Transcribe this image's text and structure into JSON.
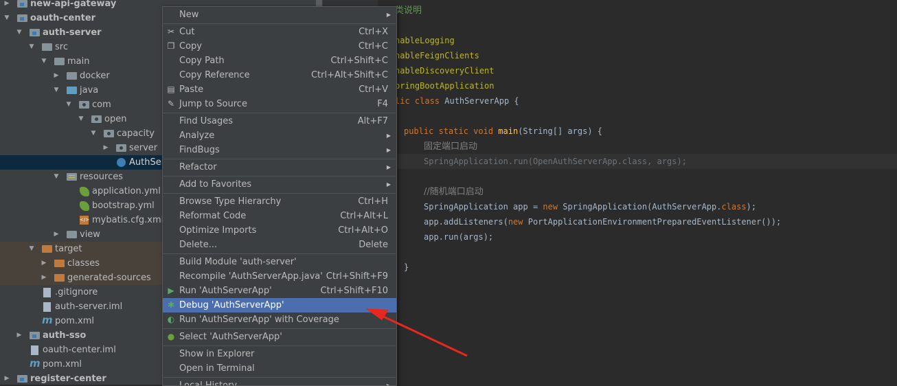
{
  "tree": [
    {
      "label": "new-api-gateway",
      "bold": true
    },
    {
      "label": "oauth-center",
      "bold": true
    },
    {
      "label": "auth-server",
      "bold": true
    },
    {
      "label": "src"
    },
    {
      "label": "main"
    },
    {
      "label": "docker"
    },
    {
      "label": "java"
    },
    {
      "label": "com"
    },
    {
      "label": "open"
    },
    {
      "label": "capacity"
    },
    {
      "label": "server"
    },
    {
      "label": "AuthServ"
    },
    {
      "label": "resources"
    },
    {
      "label": "application.yml"
    },
    {
      "label": "bootstrap.yml"
    },
    {
      "label": "mybatis.cfg.xml"
    },
    {
      "label": "view"
    },
    {
      "label": "target"
    },
    {
      "label": "classes"
    },
    {
      "label": "generated-sources"
    },
    {
      "label": ".gitignore"
    },
    {
      "label": "auth-server.iml"
    },
    {
      "label": "pom.xml"
    },
    {
      "label": "auth-sso",
      "bold": true
    },
    {
      "label": "oauth-center.iml"
    },
    {
      "label": "pom.xml"
    },
    {
      "label": "register-center",
      "bold": true
    }
  ],
  "editor": {
    "comment_top": "类说明",
    "annotations": [
      "nableLogging",
      "nableFeignClients",
      "nableDiscoveryClient",
      "pringBootApplication"
    ],
    "class_decl": {
      "kw": "lic class ",
      "name": "AuthServerApp {"
    },
    "main_decl": {
      "kw": "public static void ",
      "fn": "main",
      "rest": "(String[] args) {"
    },
    "comment_fixed": "固定端口启动",
    "fixed_run": "SpringApplication.run(OpenAuthServerApp.class, args);",
    "comment_random": "//随机端口启动",
    "line_app": {
      "a": "SpringApplication app = ",
      "kw": "new ",
      "b": "SpringApplication(AuthServerApp.",
      "kw2": "class",
      "c": ");"
    },
    "line_listeners": {
      "a": "app.addListeners(",
      "kw": "new ",
      "b": "PortApplicationEnvironmentPreparedEventListener());"
    },
    "line_run": "app.run(args);",
    "close_brace": "}"
  },
  "menu": [
    {
      "label": "New",
      "shortcut": "",
      "submenu": true
    },
    {
      "label": "Cut",
      "shortcut": "Ctrl+X",
      "icon": "cut-icon",
      "glyph": "✂"
    },
    {
      "label": "Copy",
      "shortcut": "Ctrl+C",
      "icon": "copy-icon",
      "glyph": "❐"
    },
    {
      "label": "Copy Path",
      "shortcut": "Ctrl+Shift+C"
    },
    {
      "label": "Copy Reference",
      "shortcut": "Ctrl+Alt+Shift+C"
    },
    {
      "label": "Paste",
      "shortcut": "Ctrl+V",
      "icon": "paste-icon",
      "glyph": "▤"
    },
    {
      "label": "Jump to Source",
      "shortcut": "F4",
      "icon": "pencil-icon",
      "glyph": "✎"
    },
    {
      "label": "Find Usages",
      "shortcut": "Alt+F7"
    },
    {
      "label": "Analyze",
      "shortcut": "",
      "submenu": true
    },
    {
      "label": "FindBugs",
      "shortcut": "",
      "submenu": true
    },
    {
      "label": "Refactor",
      "shortcut": "",
      "submenu": true
    },
    {
      "label": "Add to Favorites",
      "shortcut": "",
      "submenu": true
    },
    {
      "label": "Browse Type Hierarchy",
      "shortcut": "Ctrl+H"
    },
    {
      "label": "Reformat Code",
      "shortcut": "Ctrl+Alt+L"
    },
    {
      "label": "Optimize Imports",
      "shortcut": "Ctrl+Alt+O"
    },
    {
      "label": "Delete...",
      "shortcut": "Delete"
    },
    {
      "label": "Build Module 'auth-server'",
      "shortcut": ""
    },
    {
      "label": "Recompile 'AuthServerApp.java'",
      "shortcut": "Ctrl+Shift+F9"
    },
    {
      "label": "Run 'AuthServerApp'",
      "shortcut": "Ctrl+Shift+F10",
      "icon": "run-icon",
      "glyph": "▶"
    },
    {
      "label": "Debug 'AuthServerApp'",
      "shortcut": "",
      "icon": "debug-icon",
      "glyph": "✱",
      "active": true
    },
    {
      "label": "Run 'AuthServerApp' with Coverage",
      "shortcut": "",
      "icon": "coverage-icon",
      "glyph": "◐"
    },
    {
      "label": "Select 'AuthServerApp'",
      "shortcut": "",
      "icon": "spring-select-icon",
      "glyph": "●"
    },
    {
      "label": "Show in Explorer",
      "shortcut": ""
    },
    {
      "label": "Open in Terminal",
      "shortcut": ""
    },
    {
      "label": "Local History",
      "shortcut": "",
      "submenu": true
    }
  ],
  "colors": {
    "highlight": "#4b6eaf",
    "arrow": "#e8281e"
  }
}
